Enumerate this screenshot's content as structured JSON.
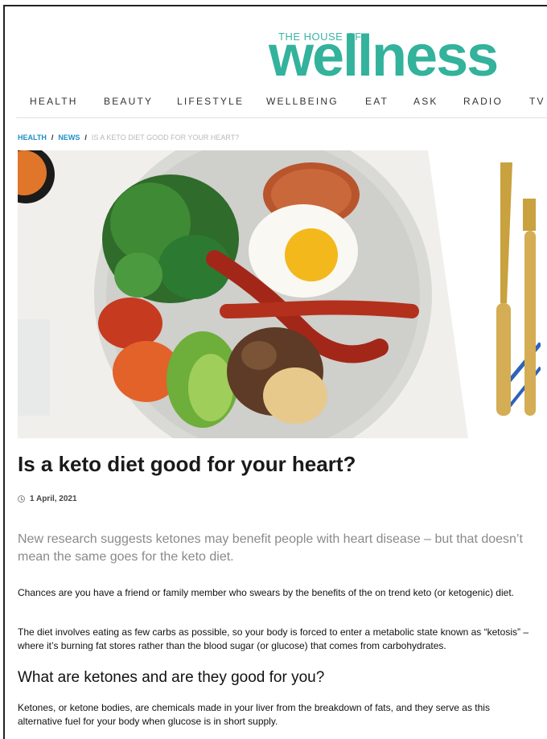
{
  "logo": {
    "small": "THE HOUSE OF",
    "big": "wellness",
    "color": "#33b29c"
  },
  "nav": {
    "items": [
      "HEALTH",
      "BEAUTY",
      "LIFESTYLE",
      "WELLBEING",
      "EAT",
      "ASK",
      "RADIO",
      "TV"
    ]
  },
  "breadcrumb": {
    "items": [
      "HEALTH",
      "NEWS"
    ],
    "separator": "/",
    "current": "IS A KETO DIET GOOD FOR YOUR HEART?",
    "link_color": "#1e8fcb"
  },
  "article": {
    "title": "Is a keto diet good for your heart?",
    "date": "1 April, 2021",
    "standfirst": "New research suggests ketones may benefit people with heart disease – but that doesn’t mean the same goes for the keto diet.",
    "paragraphs": [
      "Chances are you have a friend or family member who swears by the benefits of the on trend keto (or ketogenic) diet.",
      "The diet involves eating as few carbs as possible, so your body is forced to enter a metabolic state known as “ketosis” – where it’s burning fat stores rather than the blood sugar (or glucose) that comes from carbohydrates.",
      "Ketones, or ketone bodies, are chemicals made in your liver from the breakdown of fats, and they serve as this alternative fuel for your body when glucose is in short supply."
    ],
    "subheading": "What are ketones and are they good for you?"
  }
}
